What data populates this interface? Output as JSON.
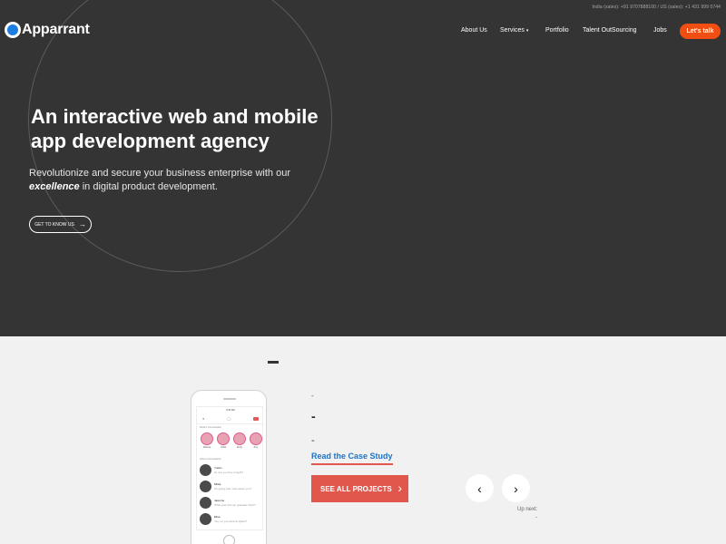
{
  "topbar": {
    "contact": "India (sales): +91 9707888100 / US (sales): +1 431 999 0744"
  },
  "brand": {
    "name": "Apparrant"
  },
  "nav": {
    "items": [
      "About Us",
      "Services",
      "Portfolio",
      "Talent OutSourcing",
      "Jobs"
    ],
    "services_caret": "▾",
    "cta": "Let's talk"
  },
  "hero": {
    "title": "An interactive web and mobile app development agency",
    "subtitle_pre": "Revolutionize and secure your business enterprise with our ",
    "subtitle_em": "excellence",
    "subtitle_post": " in digital product development.",
    "button_label": "GET TO KNOW US",
    "button_arrow": "→"
  },
  "projects": {
    "case_study": {
      "small": "-",
      "big": "-",
      "mid": "-",
      "link": "Read the Case Study"
    },
    "see_all_label": "SEE ALL PROJECTS",
    "see_all_chevron": "›",
    "prev_glyph": "‹",
    "next_glyph": "›",
    "up_next_label": "Up next:",
    "up_next_value": "-"
  },
  "phone": {
    "status_time": "9:41 AM",
    "stories_heading": "Week 1 Conversation",
    "stories": [
      "Melissa",
      "Ishita",
      "Emily",
      "Amy"
    ],
    "chats_heading": "Active Conversations",
    "chats": [
      {
        "name": "Yuwiin",
        "msg": "Hi, are you free tonight?"
      },
      {
        "name": "Mirka",
        "msg": "It's going well. How about you?"
      },
      {
        "name": "Jasmine",
        "msg": "What year did you graduate SCU?"
      },
      {
        "name": "Elise",
        "msg": "Yes, so you work at Qlash?"
      }
    ]
  },
  "colors": {
    "accent": "#e2574c",
    "cta": "#f04e12",
    "link": "#1e72c6",
    "hero_bg": "#343434"
  }
}
